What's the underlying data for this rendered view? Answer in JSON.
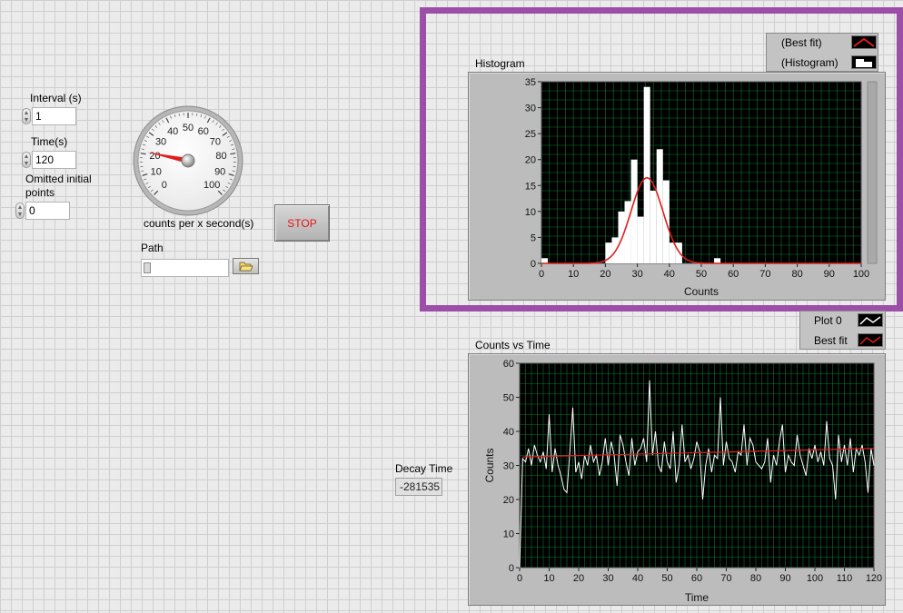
{
  "controls": {
    "interval": {
      "label": "Interval (s)",
      "value": "1"
    },
    "time": {
      "label": "Time(s)",
      "value": "120"
    },
    "omitted": {
      "label_line1": "Omitted initial",
      "label_line2": "points",
      "value": "0"
    }
  },
  "gauge": {
    "caption": "counts per x second(s)",
    "ticks": [
      "0",
      "10",
      "20",
      "30",
      "40",
      "50",
      "60",
      "70",
      "80",
      "90",
      "100"
    ],
    "min": 0,
    "max": 100,
    "value": 21
  },
  "stop_button": {
    "label": "STOP",
    "text_color": "#e8141b"
  },
  "path": {
    "label": "Path",
    "value": ""
  },
  "decay": {
    "label": "Decay Time",
    "value": "-281535"
  },
  "colors": {
    "plot_bg": "#000000",
    "grid": "#0a8a3a",
    "fit_line": "#e21c1c",
    "data": "#ffffff",
    "highlight": "#9b4fa6"
  },
  "histogram_legend": {
    "items": [
      {
        "label": "(Best fit)"
      },
      {
        "label": "(Histogram)"
      }
    ]
  },
  "counts_legend": {
    "items": [
      {
        "label": "Plot 0"
      },
      {
        "label": "Best fit"
      }
    ]
  },
  "chart_data": [
    {
      "type": "bar",
      "title": "Histogram",
      "xlabel": "Counts",
      "ylabel": "",
      "xlim": [
        0,
        100
      ],
      "ylim": [
        0,
        35
      ],
      "xticks": [
        "0",
        "10",
        "20",
        "30",
        "40",
        "50",
        "60",
        "70",
        "80",
        "90",
        "100"
      ],
      "yticks": [
        "0",
        "5",
        "10",
        "15",
        "20",
        "25",
        "30",
        "35"
      ],
      "bins_x": [
        0,
        2,
        20,
        22,
        24,
        26,
        28,
        30,
        32,
        34,
        36,
        38,
        40,
        42,
        54
      ],
      "bins_y": [
        1,
        0,
        4,
        5,
        10,
        12,
        20,
        9,
        34,
        14,
        22,
        16,
        4,
        4,
        1
      ],
      "bin_width": 2,
      "series": [
        {
          "name": "(Histogram)"
        },
        {
          "name": "(Best fit)"
        }
      ],
      "fit": {
        "type": "gaussian",
        "mean": 33,
        "sigma": 5,
        "amplitude": 16.5
      },
      "grid": true,
      "legend": "top-right"
    },
    {
      "type": "line",
      "title": "Counts vs Time",
      "xlabel": "Time",
      "ylabel": "Counts",
      "xlim": [
        0,
        120
      ],
      "ylim": [
        0,
        60
      ],
      "xticks": [
        "0",
        "10",
        "20",
        "30",
        "40",
        "50",
        "60",
        "70",
        "80",
        "90",
        "100",
        "110",
        "120"
      ],
      "yticks": [
        "0",
        "10",
        "20",
        "30",
        "40",
        "50",
        "60"
      ],
      "series": [
        {
          "name": "Plot 0",
          "x_start": 0,
          "x_step": 1,
          "values": [
            0,
            32,
            31,
            35,
            30,
            36,
            33,
            31,
            34,
            29,
            45,
            28,
            35,
            30,
            27,
            23,
            22,
            34,
            47,
            28,
            31,
            26,
            33,
            30,
            36,
            31,
            33,
            27,
            31,
            38,
            30,
            37,
            33,
            24,
            39,
            36,
            31,
            27,
            38,
            30,
            34,
            35,
            38,
            31,
            55,
            33,
            40,
            30,
            28,
            37,
            31,
            29,
            40,
            25,
            30,
            42,
            31,
            33,
            29,
            32,
            37,
            34,
            20,
            30,
            35,
            28,
            33,
            32,
            50,
            30,
            37,
            32,
            31,
            28,
            34,
            33,
            42,
            30,
            38,
            36,
            31,
            30,
            29,
            31,
            38,
            25,
            33,
            30,
            37,
            42,
            28,
            33,
            31,
            30,
            39,
            33,
            30,
            27,
            35,
            32,
            36,
            31,
            34,
            30,
            43,
            32,
            30,
            20,
            39,
            31,
            36,
            30,
            38,
            28,
            35,
            33,
            36,
            31,
            22,
            35,
            30
          ]
        },
        {
          "name": "Best fit",
          "x": [
            1,
            120
          ],
          "values": [
            32.5,
            35
          ]
        }
      ],
      "grid": true,
      "legend": "top-right"
    }
  ]
}
